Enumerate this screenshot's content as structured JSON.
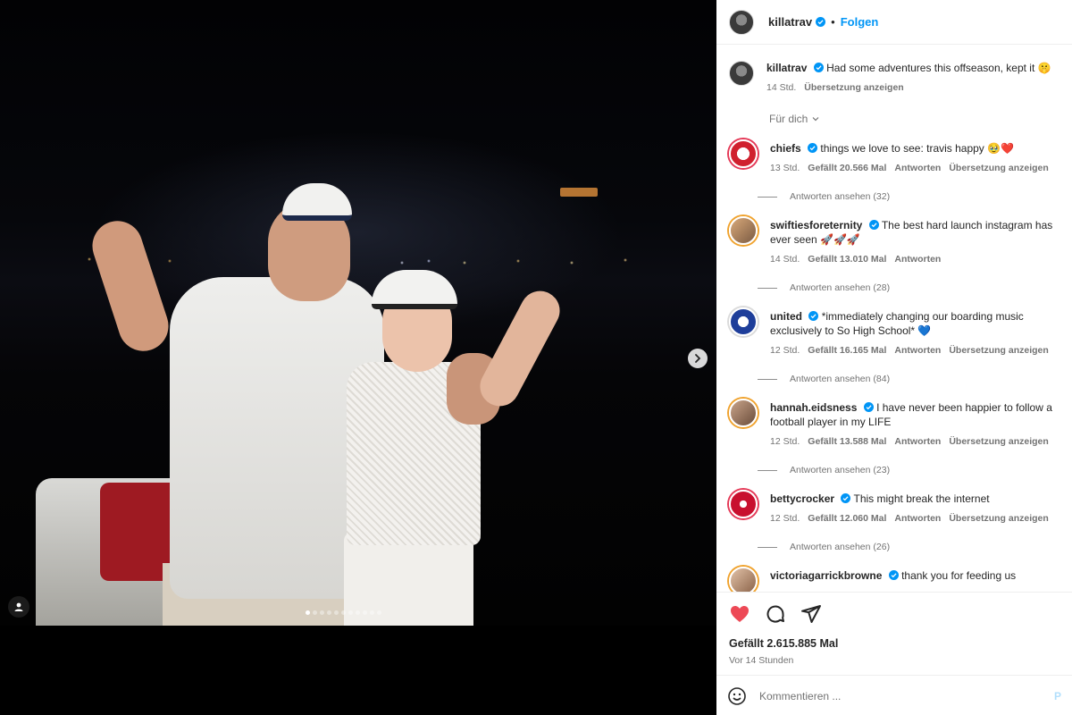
{
  "colors": {
    "accent": "#0095f6",
    "like_red": "#ed4956",
    "muted": "#737373"
  },
  "header": {
    "username": "killatrav",
    "follow_label": "Folgen",
    "separator": "•"
  },
  "caption": {
    "username": "killatrav",
    "text": "Had some adventures this offseason, kept it 🤫",
    "time": "14 Std.",
    "translate_label": "Übersetzung anzeigen"
  },
  "filter_label": "Für dich",
  "comments": [
    {
      "username": "chiefs",
      "text": "things we love to see: travis happy 🥹❤️",
      "time": "13 Std.",
      "likes": "Gefällt 20.566 Mal",
      "reply_label": "Antworten",
      "translate_label": "Übersetzung anzeigen",
      "view_replies": "Antworten ansehen (32)"
    },
    {
      "username": "swiftiesforeternity",
      "text": "The best hard launch instagram has ever seen 🚀🚀🚀",
      "time": "14 Std.",
      "likes": "Gefällt 13.010 Mal",
      "reply_label": "Antworten",
      "translate_label": "",
      "view_replies": "Antworten ansehen (28)"
    },
    {
      "username": "united",
      "text": "*immediately changing our boarding music exclusively to So High School* 💙",
      "time": "12 Std.",
      "likes": "Gefällt 16.165 Mal",
      "reply_label": "Antworten",
      "translate_label": "Übersetzung anzeigen",
      "view_replies": "Antworten ansehen (84)"
    },
    {
      "username": "hannah.eidsness",
      "text": "I have never been happier to follow a football player in my LIFE",
      "time": "12 Std.",
      "likes": "Gefällt 13.588 Mal",
      "reply_label": "Antworten",
      "translate_label": "Übersetzung anzeigen",
      "view_replies": "Antworten ansehen (23)"
    },
    {
      "username": "bettycrocker",
      "text": "This might break the internet",
      "time": "12 Std.",
      "likes": "Gefällt 12.060 Mal",
      "reply_label": "Antworten",
      "translate_label": "Übersetzung anzeigen",
      "view_replies": "Antworten ansehen (26)"
    },
    {
      "username": "victoriagarrickbrowne",
      "text": "thank you for feeding us",
      "time": "",
      "likes": "",
      "reply_label": "",
      "translate_label": "",
      "view_replies": ""
    }
  ],
  "actions": {
    "icons": [
      "heart-icon",
      "comment-icon",
      "share-icon"
    ],
    "likes_text": "Gefällt 2.615.885 Mal",
    "time_ago": "Vor 14 Stunden"
  },
  "comment_input": {
    "placeholder": "Kommentieren ...",
    "post_label": "P"
  },
  "carousel": {
    "slide_count": 11,
    "active_index": 0
  }
}
